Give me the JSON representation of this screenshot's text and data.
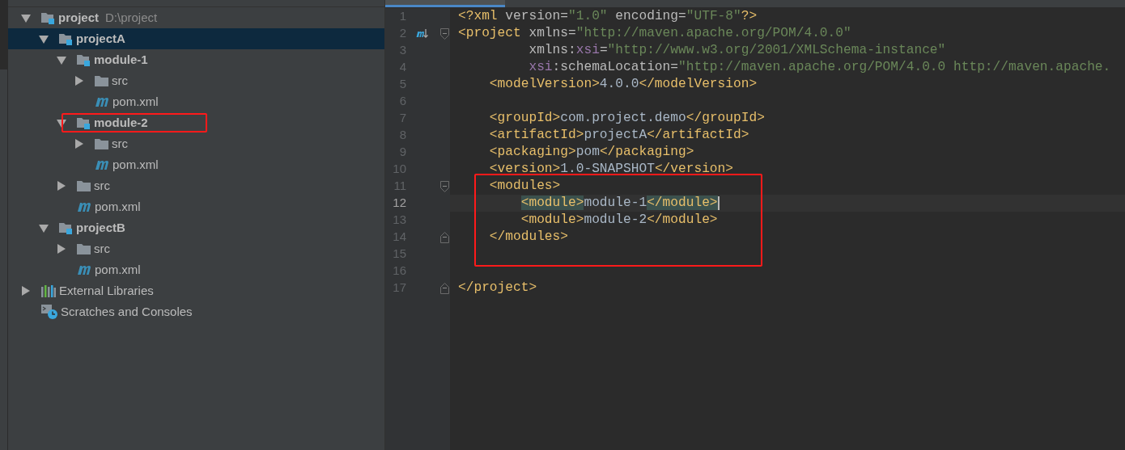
{
  "project_tree": {
    "items": [
      {
        "label": "project",
        "location": "D:\\project",
        "kind": "module",
        "expanded": true,
        "selected": false,
        "annotated": false,
        "children": [
          {
            "label": "projectA",
            "kind": "module",
            "expanded": true,
            "selected": true,
            "annotated": false,
            "children": [
              {
                "label": "module-1",
                "kind": "module",
                "expanded": true,
                "selected": false,
                "annotated": false,
                "children": [
                  {
                    "label": "src",
                    "kind": "folder",
                    "expanded": false,
                    "selected": false,
                    "annotated": false
                  },
                  {
                    "label": "pom.xml",
                    "kind": "pom",
                    "selected": false,
                    "annotated": false
                  }
                ]
              },
              {
                "label": "module-2",
                "kind": "module",
                "expanded": true,
                "selected": false,
                "annotated": true,
                "children": [
                  {
                    "label": "src",
                    "kind": "folder",
                    "expanded": false,
                    "selected": false,
                    "annotated": false
                  },
                  {
                    "label": "pom.xml",
                    "kind": "pom",
                    "selected": false,
                    "annotated": false
                  }
                ]
              },
              {
                "label": "src",
                "kind": "folder",
                "expanded": false,
                "selected": false,
                "annotated": false
              },
              {
                "label": "pom.xml",
                "kind": "pom",
                "selected": false,
                "annotated": false
              }
            ]
          },
          {
            "label": "projectB",
            "kind": "module",
            "expanded": true,
            "selected": false,
            "annotated": false,
            "children": [
              {
                "label": "src",
                "kind": "folder",
                "expanded": false,
                "selected": false,
                "annotated": false
              },
              {
                "label": "pom.xml",
                "kind": "pom",
                "selected": false,
                "annotated": false
              }
            ]
          }
        ]
      },
      {
        "label": "External Libraries",
        "kind": "libraries",
        "expanded": false,
        "selected": false,
        "annotated": false
      },
      {
        "label": "Scratches and Consoles",
        "kind": "scratches",
        "selected": false,
        "annotated": false
      }
    ]
  },
  "editor": {
    "lines": [
      {
        "number": "1",
        "current": false,
        "annotated": false,
        "tokens": [
          {
            "t": "<?xml ",
            "kind": "tag"
          },
          {
            "t": "version=",
            "kind": "plain"
          },
          {
            "t": "\"1.0\"",
            "kind": "str"
          },
          {
            "t": " encoding=",
            "kind": "plain"
          },
          {
            "t": "\"UTF-8\"",
            "kind": "str"
          },
          {
            "t": "?>",
            "kind": "tag"
          }
        ]
      },
      {
        "number": "2",
        "current": false,
        "annotated": false,
        "maven_marker": true,
        "fold_start": true,
        "tokens": [
          {
            "t": "<project ",
            "kind": "tag"
          },
          {
            "t": "xmlns=",
            "kind": "plain"
          },
          {
            "t": "\"http://maven.apache.org/POM/4.0.0\"",
            "kind": "str"
          }
        ]
      },
      {
        "number": "3",
        "current": false,
        "annotated": false,
        "tokens": [
          {
            "t": "         xmlns:",
            "kind": "plain"
          },
          {
            "t": "xsi",
            "kind": "ns"
          },
          {
            "t": "=",
            "kind": "plain"
          },
          {
            "t": "\"http://www.w3.org/2001/XMLSchema-instance\"",
            "kind": "str"
          }
        ]
      },
      {
        "number": "4",
        "current": false,
        "annotated": false,
        "tokens": [
          {
            "t": "         xsi",
            "kind": "ns"
          },
          {
            "t": ":schemaLocation=",
            "kind": "plain"
          },
          {
            "t": "\"http://maven.apache.org/POM/4.0.0 http://maven.apache.",
            "kind": "str"
          }
        ]
      },
      {
        "number": "5",
        "current": false,
        "annotated": false,
        "tokens": [
          {
            "t": "    <modelVersion>",
            "kind": "tag"
          },
          {
            "t": "4.0.0",
            "kind": "text"
          },
          {
            "t": "</modelVersion>",
            "kind": "tag"
          }
        ]
      },
      {
        "number": "6",
        "current": false,
        "annotated": false
      },
      {
        "number": "7",
        "current": false,
        "annotated": false,
        "tokens": [
          {
            "t": "    <groupId>",
            "kind": "tag"
          },
          {
            "t": "com.project.demo",
            "kind": "text"
          },
          {
            "t": "</groupId>",
            "kind": "tag"
          }
        ]
      },
      {
        "number": "8",
        "current": false,
        "annotated": false,
        "tokens": [
          {
            "t": "    <artifactId>",
            "kind": "tag"
          },
          {
            "t": "projectA",
            "kind": "text"
          },
          {
            "t": "</artifactId>",
            "kind": "tag"
          }
        ]
      },
      {
        "number": "9",
        "current": false,
        "annotated": false,
        "tokens": [
          {
            "t": "    <packaging>",
            "kind": "tag"
          },
          {
            "t": "pom",
            "kind": "text"
          },
          {
            "t": "</packaging>",
            "kind": "tag"
          }
        ]
      },
      {
        "number": "10",
        "current": false,
        "annotated": false,
        "tokens": [
          {
            "t": "    <version>",
            "kind": "tag"
          },
          {
            "t": "1.0-SNAPSHOT",
            "kind": "text"
          },
          {
            "t": "</version>",
            "kind": "tag"
          }
        ]
      },
      {
        "number": "11",
        "current": false,
        "annotated": true,
        "fold_start": true,
        "tokens": [
          {
            "t": "    <modules>",
            "kind": "tag"
          }
        ]
      },
      {
        "number": "12",
        "current": true,
        "annotated": true,
        "tokens": [
          {
            "t": "        <module>",
            "kind": "match"
          },
          {
            "t": "module-1",
            "kind": "text"
          },
          {
            "t": "</module>",
            "kind": "match"
          }
        ]
      },
      {
        "number": "13",
        "current": false,
        "annotated": true,
        "tokens": [
          {
            "t": "        <module>",
            "kind": "tag"
          },
          {
            "t": "module-2",
            "kind": "text"
          },
          {
            "t": "</module>",
            "kind": "tag"
          }
        ]
      },
      {
        "number": "14",
        "current": false,
        "annotated": true,
        "fold_end": true,
        "tokens": [
          {
            "t": "    </modules>",
            "kind": "tag"
          }
        ]
      },
      {
        "number": "15",
        "current": false,
        "annotated": true
      },
      {
        "number": "16",
        "current": false,
        "annotated": false
      },
      {
        "number": "17",
        "current": false,
        "annotated": false,
        "fold_end": true,
        "tokens": [
          {
            "t": "</project>",
            "kind": "tag"
          }
        ]
      }
    ]
  }
}
